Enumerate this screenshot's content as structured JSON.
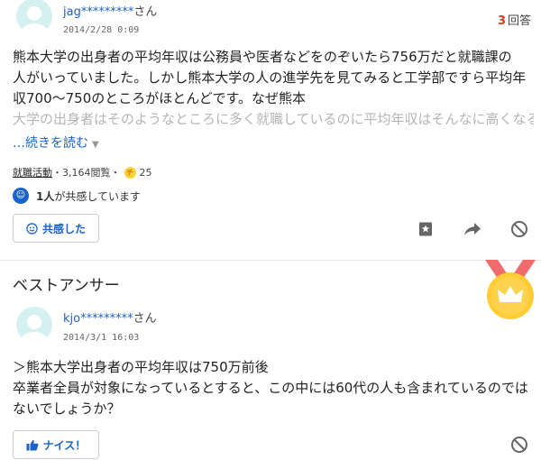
{
  "question": {
    "username": "jag*********",
    "username_suffix": "さん",
    "date": "2014/2/28 0:09",
    "answers_count": "3",
    "answers_label": "回答",
    "body_lines": [
      "熊本大学の出身者の平均年収は公務員や医者などをのぞいたら756万だと就職課の",
      "人がいっていました。しかし熊本大学の人の進学先を見てみると工学部ですら平均年",
      "収700〜750のところがほとんどです。なぜ熊本"
    ],
    "faded_line": "大学の出身者はそのようなところに多く就職しているのに平均年収はそんなに高くなる",
    "read_more": "…続きを読む",
    "category": "就職活動",
    "views": "・3,164閲覧・",
    "coin_symbol": "チ",
    "coins": "25",
    "empathy_count": "1人",
    "empathy_text": "が共感しています",
    "empathy_button": "共感した"
  },
  "best_answer": {
    "title": "ベストアンサー",
    "username": "kjo*********",
    "username_suffix": "さん",
    "date": "2014/3/1 16:03",
    "body_lines": [
      "＞熊本大学出身者の平均年収は750万前後",
      "卒業者全員が対象になっているとすると、この中には60代の人も含まれているのでは",
      "ないでしょうか？"
    ],
    "nice_button": "ナイス！"
  },
  "colors": {
    "link": "#1a63c8",
    "answers_num": "#e03a1e",
    "medal_ribbon": "#f06b6b",
    "medal": "#ffcc33",
    "avatar": "#d4f0f0"
  },
  "icons": [
    "bookmark-icon",
    "share-arrow-icon",
    "block-icon",
    "smile-icon",
    "thumbs-up-icon",
    "crown-medal-icon"
  ]
}
